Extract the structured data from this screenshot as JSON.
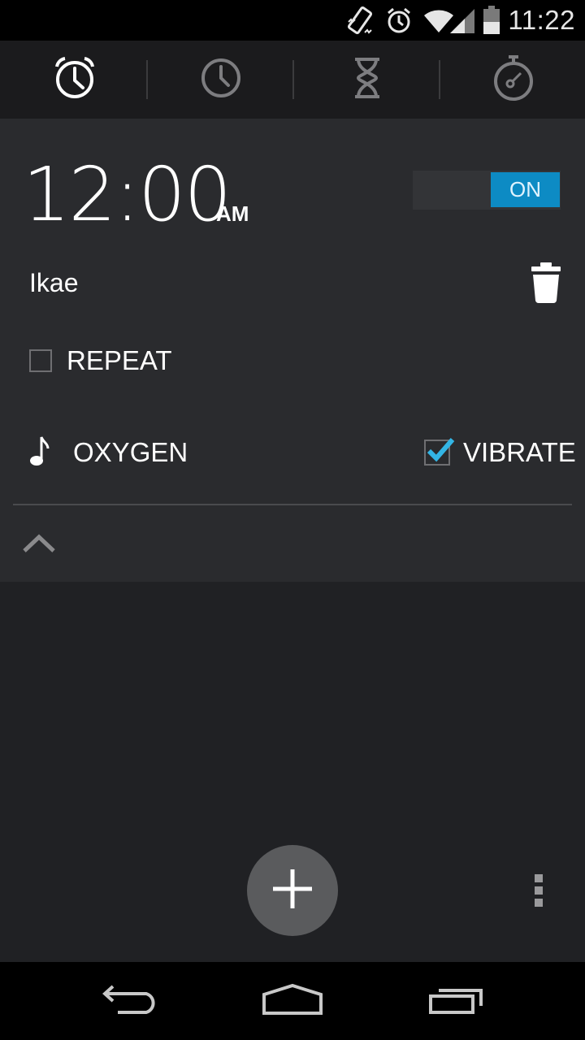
{
  "status_bar": {
    "time": "11:22",
    "icons": [
      "vibrate-icon",
      "alarm-icon",
      "wifi-icon",
      "signal-icon",
      "battery-icon"
    ]
  },
  "tabs": [
    {
      "name": "alarm",
      "icon": "alarm-clock-icon",
      "selected": true
    },
    {
      "name": "clock",
      "icon": "clock-icon",
      "selected": false
    },
    {
      "name": "timer",
      "icon": "hourglass-icon",
      "selected": false
    },
    {
      "name": "stopwatch",
      "icon": "stopwatch-icon",
      "selected": false
    }
  ],
  "alarm": {
    "time": "12:00",
    "ampm": "AM",
    "toggle_label": "ON",
    "enabled": true,
    "label": "Ikae",
    "repeat_label": "REPEAT",
    "repeat_checked": false,
    "ringtone": "OXYGEN",
    "vibrate_label": "VIBRATE",
    "vibrate_checked": true
  },
  "colors": {
    "accent": "#0d8bc4",
    "check": "#33b5e5",
    "background": "#202124",
    "card": "#2a2b2e"
  },
  "nav": [
    "back-icon",
    "home-icon",
    "recents-icon"
  ]
}
